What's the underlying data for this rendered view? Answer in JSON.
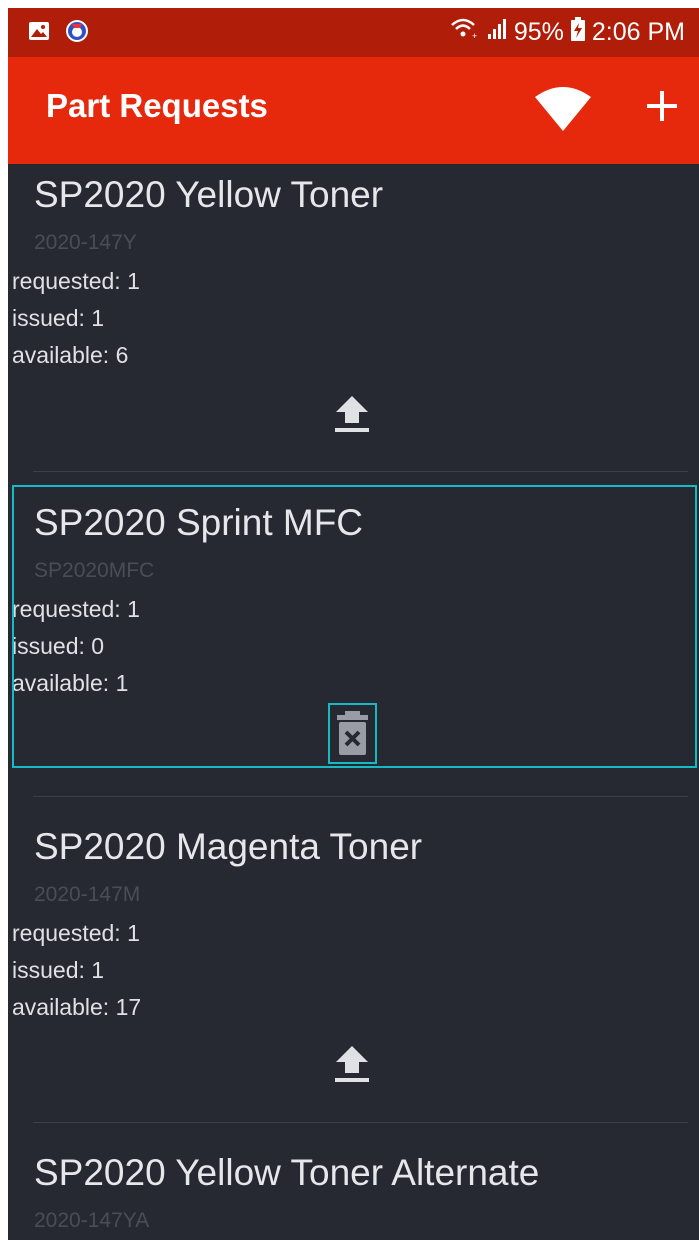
{
  "status_bar": {
    "battery": "95%",
    "time": "2:06 PM"
  },
  "app_bar": {
    "title": "Part Requests"
  },
  "items": [
    {
      "name": "SP2020 Yellow Toner",
      "code": "2020-147Y",
      "requested": "requested: 1",
      "issued": "issued: 1",
      "available": "available: 6",
      "action": "upload-icon"
    },
    {
      "name": "SP2020 Sprint MFC",
      "code": "SP2020MFC",
      "requested": "requested: 1",
      "issued": "issued: 0",
      "available": "available: 1",
      "action": "delete-icon"
    },
    {
      "name": "SP2020 Magenta Toner",
      "code": "2020-147M",
      "requested": "requested: 1",
      "issued": "issued: 1",
      "available": "available: 17",
      "action": "upload-icon"
    },
    {
      "name": "SP2020 Yellow Toner Alternate",
      "code": "2020-147YA"
    }
  ],
  "colors": {
    "status_bar": "#b01d08",
    "app_bar": "#e6290c",
    "background": "#262832",
    "selection": "#17b9c3"
  }
}
